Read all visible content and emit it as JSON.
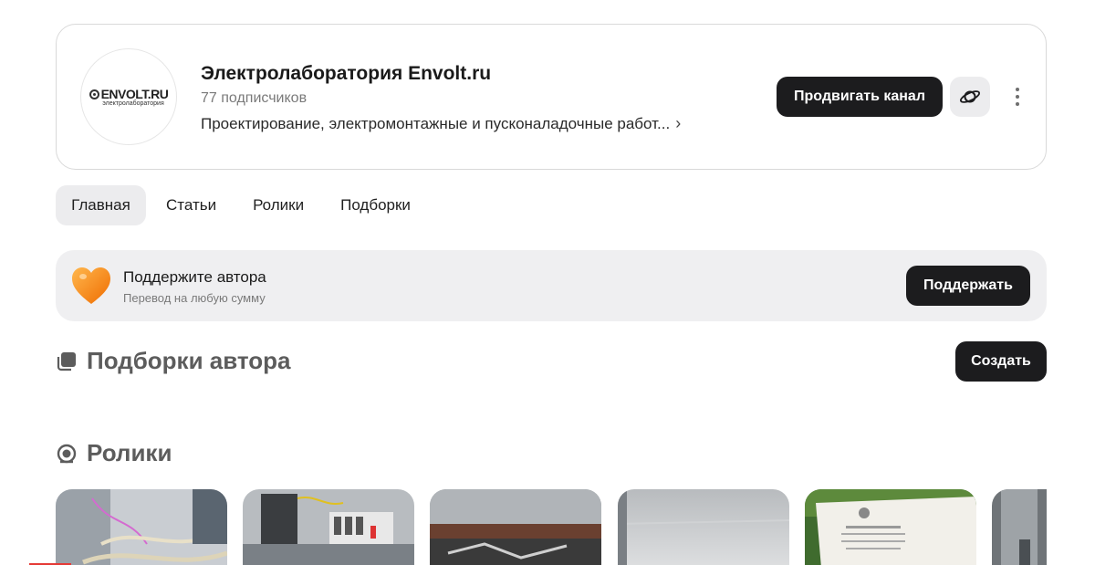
{
  "channel": {
    "avatar_brand": "ENVOLT.RU",
    "avatar_sub": "электролаборатория",
    "title": "Электролаборатория Envolt.ru",
    "subscribers": "77 подписчиков",
    "description": "Проектирование, электромонтажные и пусконаладочные работ...",
    "promote_label": "Продвигать канал"
  },
  "tabs": [
    {
      "label": "Главная",
      "active": true
    },
    {
      "label": "Статьи",
      "active": false
    },
    {
      "label": "Ролики",
      "active": false
    },
    {
      "label": "Подборки",
      "active": false
    }
  ],
  "support": {
    "title": "Поддержите автора",
    "subtitle": "Перевод на любую сумму",
    "button_label": "Поддержать"
  },
  "collections_section": {
    "title": "Подборки автора",
    "create_label": "Создать"
  },
  "videos_section": {
    "title": "Ролики"
  },
  "icons": {
    "planet": "planet-icon",
    "more": "more-vertical-icon",
    "heart": "heart-icon",
    "collections": "stack-icon",
    "videos": "play-circle-icon",
    "chevron": "chevron-right-icon"
  },
  "colors": {
    "dark_button": "#1c1c1e",
    "muted_bg": "#efeff1",
    "heart": "#f57c00"
  }
}
